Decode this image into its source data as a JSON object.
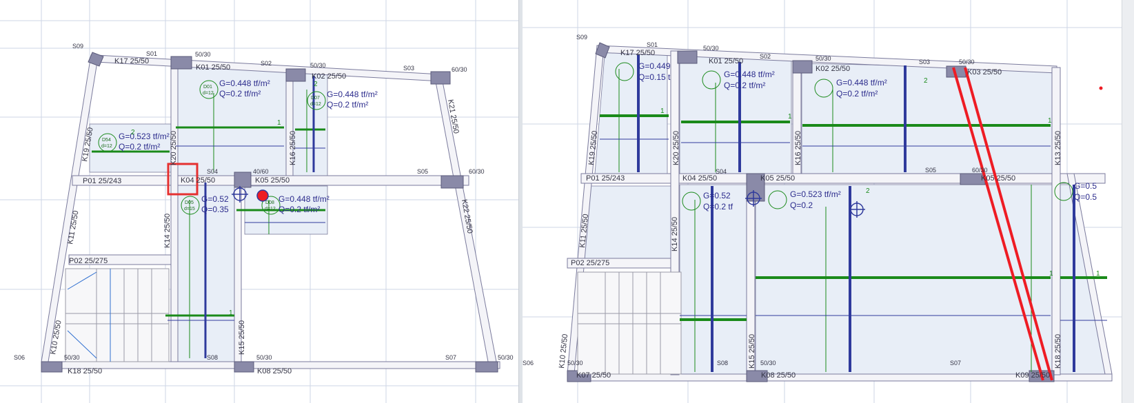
{
  "colors": {
    "grid": "#cdd6e6",
    "wall": "#7a7a9c",
    "slab_fill": "#e8eef7",
    "beam_text": "#333344",
    "load_text": "#2b2b8c",
    "green": "#1a8a1a",
    "blue": "#2f3a9c",
    "red": "#ee1c24",
    "selection": "#e53030"
  },
  "left": {
    "columns": {
      "s09": "S09",
      "s01": "S01",
      "s02": "S02",
      "s03": "S03",
      "s04": "S04",
      "s05": "S05",
      "s06": "S06",
      "s07": "S07",
      "s08": "S08",
      "c5030a": "50/30",
      "c5030b": "50/30",
      "c5030c": "50/30",
      "c6030a": "60/30",
      "c4060": "40/60",
      "c6030b": "60/30",
      "c5030d": "50/30",
      "c5030e": "50/30"
    },
    "beams": {
      "k17": "K17 25/50",
      "k01": "K01 25/50",
      "k02": "K02 25/50",
      "k21": "K21 25/50",
      "k19": "K19 25/50",
      "k20": "K20 25/50",
      "k16": "K16 25/50",
      "k04": "K04 25/50",
      "k05": "K05 25/50",
      "k22": "K22 25/50",
      "k11": "K11 25/50",
      "k14": "K14 25/50",
      "k10": "K10 25/50",
      "k15": "K15 25/50",
      "k18": "K18 25/50",
      "k08": "K08 25/50"
    },
    "panels": {
      "p01": "P01 25/243",
      "p02": "P02 25/275"
    },
    "slabs": {
      "d01": {
        "id": "D01",
        "thick": "d=12",
        "g": "G=0.448 tf/m²",
        "q": "Q=0.2 tf/m²"
      },
      "d07": {
        "id": "D07",
        "thick": "d=12",
        "g": "G=0.448 tf/m²",
        "q": "Q=0.2 tf/m²"
      },
      "d54": {
        "id": "D54",
        "thick": "d=12",
        "g": "G=0.523 tf/m²",
        "q": "Q=0.2 tf/m²"
      },
      "d05": {
        "id": "D05",
        "thick": "d=15",
        "g": "G=0.52",
        "q": "Q=0.35"
      },
      "d08": {
        "id": "D08",
        "thick": "d=12",
        "g": "G=0.448 tf/m²",
        "q": "Q=0.2 tf/m²"
      }
    },
    "dir1": "1",
    "dir2": "2"
  },
  "right": {
    "columns": {
      "s09": "S09",
      "s01": "S01",
      "s02": "S02",
      "s03": "S03",
      "s04": "S04",
      "s05": "S05",
      "s06": "S06",
      "s07": "S07",
      "s08": "S08",
      "c5030a": "50/30",
      "c5030b": "50/30",
      "c5030c": "50/30",
      "c6030": "60/30",
      "c5030d": "50/30",
      "c5030e": "50/30"
    },
    "beams": {
      "k17": "K17 25/50",
      "k01": "K01 25/50",
      "k02": "K02 25/50",
      "k03": "K03 25/50",
      "k04": "K04 25/50",
      "k05a": "K05 25/50",
      "k05b": "K05 25/50",
      "k18": "K18 25/50",
      "k07": "K07 25/50",
      "k08": "K08 25/50",
      "k09": "K09 25/50",
      "k10": "K10 25/50",
      "k11": "K11 25/50",
      "k13": "K13 25/50",
      "k14": "K14 25/50",
      "k15": "K15 25/50",
      "k16": "K16 25/50",
      "k19": "K19 25/50",
      "k20": "K20 25/50"
    },
    "panels": {
      "p01": "P01 25/243",
      "p02": "P02 25/275"
    },
    "slabs": {
      "d01": {
        "g": "G=0.449",
        "q": "Q=0.15 t"
      },
      "d02": {
        "g": "G=0.448 tf/m²",
        "q": "Q=0.2 tf/m²"
      },
      "d03": {
        "g": "G=0.448 tf/m²",
        "q": "Q=0.2 tf/m²"
      },
      "d04": {
        "g": "G=0.52",
        "q": "Q=0.2 tf"
      },
      "d06": {
        "g": "G=0.523 tf/m²",
        "q": "Q=0.2"
      },
      "d09": {
        "g": "G=0.5",
        "q": "Q=0.5"
      }
    },
    "dir1": "1",
    "dir2": "2"
  }
}
